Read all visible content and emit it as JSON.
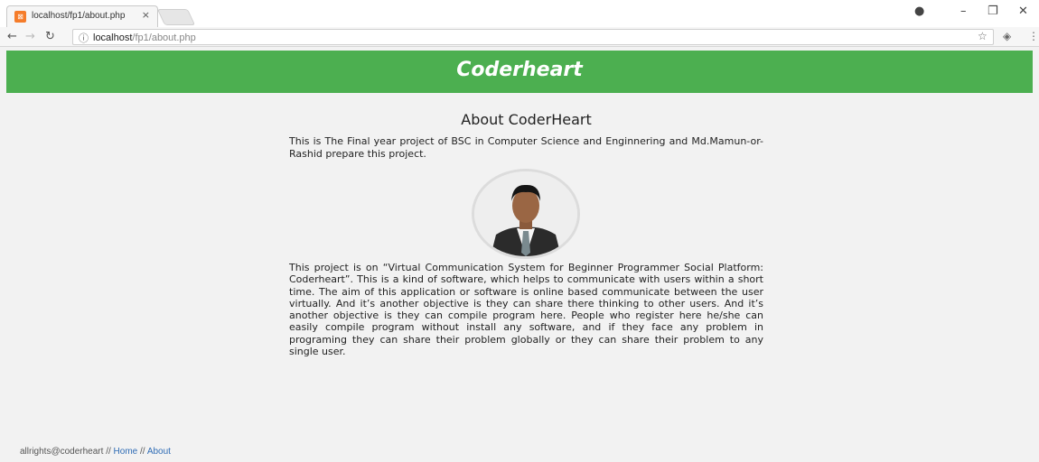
{
  "browser": {
    "tab_title": "localhost/fp1/about.php",
    "tab_close": "×",
    "favicon": "xampp-icon",
    "url_host": "localhost",
    "url_path": "/fp1/about.php",
    "icons": [
      "back-icon",
      "forward-icon",
      "reload-icon",
      "info-icon",
      "star-icon",
      "extension-icon",
      "menu-icon",
      "profile-icon",
      "minimize-icon",
      "restore-icon",
      "close-icon"
    ]
  },
  "header": {
    "brand": "Coderheart",
    "color": "#4caf50"
  },
  "main": {
    "title": "About CoderHeart",
    "intro": "This is The Final year project of BSC in Computer Science and Enginnering and Md.Mamun-or-Rashid prepare this project.",
    "description": "This project is on “Virtual Communication System for Beginner Programmer Social Platform: Coderheart”. This is a kind of software, which helps to communicate with users within a short time. The aim of this application or software is online based communicate between the user virtually. And it’s another objective is they can share there thinking to other users. And it’s another objective is they can compile program here. People who register here he/she can easily compile program without install any software, and if they face any problem in programing they can share their problem globally or they can share their problem to any single user."
  },
  "footer": {
    "copyright": "allrights@coderheart //",
    "home": "Home",
    "separator": "//",
    "about": "About",
    "link_color": "#2f6cb5"
  }
}
